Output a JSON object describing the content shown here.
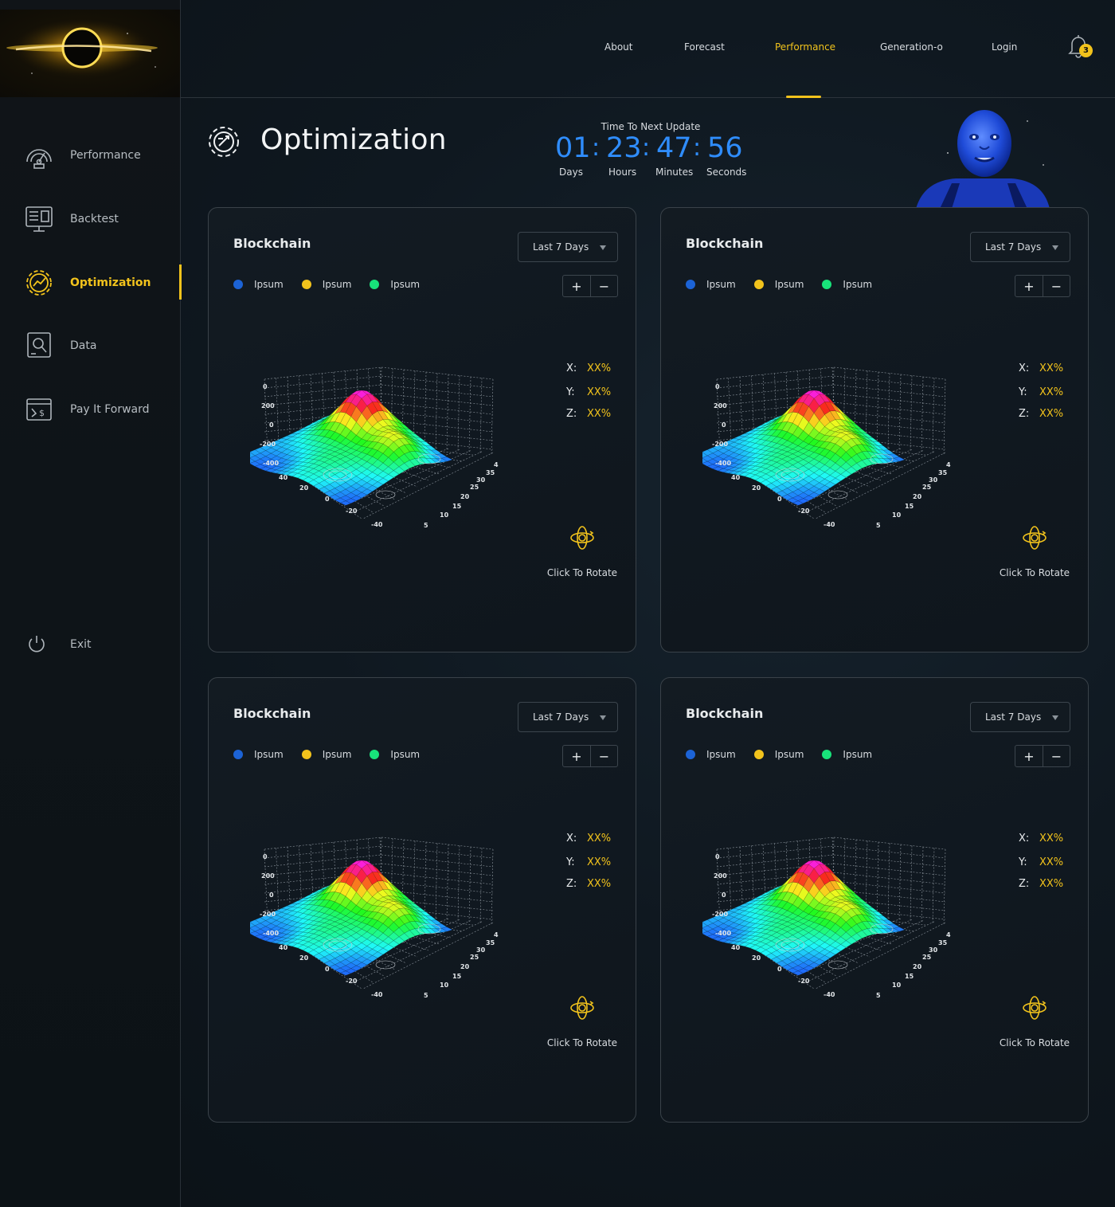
{
  "nav": {
    "links": [
      "About",
      "Forecast",
      "Performance",
      "Generation-o",
      "Login"
    ],
    "active": "Performance",
    "notification_count": "3"
  },
  "sidebar": {
    "items": [
      {
        "label": "Performance",
        "icon": "speedometer-icon"
      },
      {
        "label": "Backtest",
        "icon": "monitor-chart-icon"
      },
      {
        "label": "Optimization",
        "icon": "gear-chart-icon"
      },
      {
        "label": "Data",
        "icon": "data-search-icon"
      },
      {
        "label": "Pay It Forward",
        "icon": "payment-icon"
      }
    ],
    "active": "Optimization",
    "exit_label": "Exit"
  },
  "header": {
    "title": "Optimization",
    "countdown": {
      "title": "Time To Next Update",
      "days": "01",
      "hours": "23",
      "minutes": "47",
      "seconds": "56",
      "days_label": "Days",
      "hours_label": "Hours",
      "minutes_label": "Minutes",
      "seconds_label": "Seconds"
    }
  },
  "colors": {
    "accent": "#f2c31c",
    "countdown": "#2f8dfd",
    "legend": [
      "#1c63d6",
      "#f2c31c",
      "#18e37a"
    ]
  },
  "cards": [
    {
      "title": "Blockchain",
      "range": "Last 7 Days",
      "legend": [
        "Ipsum",
        "Ipsum",
        "Ipsum"
      ],
      "x": "XX%",
      "y": "XX%",
      "z": "XX%",
      "rotate_label": "Click To Rotate"
    },
    {
      "title": "Blockchain",
      "range": "Last 7 Days",
      "legend": [
        "Ipsum",
        "Ipsum",
        "Ipsum"
      ],
      "x": "XX%",
      "y": "XX%",
      "z": "XX%",
      "rotate_label": "Click To Rotate"
    },
    {
      "title": "Blockchain",
      "range": "Last 7 Days",
      "legend": [
        "Ipsum",
        "Ipsum",
        "Ipsum"
      ],
      "x": "XX%",
      "y": "XX%",
      "z": "XX%",
      "rotate_label": "Click To Rotate"
    },
    {
      "title": "Blockchain",
      "range": "Last 7 Days",
      "legend": [
        "Ipsum",
        "Ipsum",
        "Ipsum"
      ],
      "x": "XX%",
      "y": "XX%",
      "z": "XX%",
      "rotate_label": "Click To Rotate"
    }
  ],
  "plot_axes": {
    "z_ticks": [
      "0",
      "200",
      "0",
      "-200",
      "-400"
    ],
    "x_ticks": [
      "40",
      "20",
      "0",
      "-20",
      "-40"
    ],
    "y_ticks": [
      "5",
      "10",
      "15",
      "20",
      "25",
      "30",
      "35",
      "4"
    ]
  },
  "coord_labels": {
    "x": "X:",
    "y": "Y:",
    "z": "Z:"
  }
}
